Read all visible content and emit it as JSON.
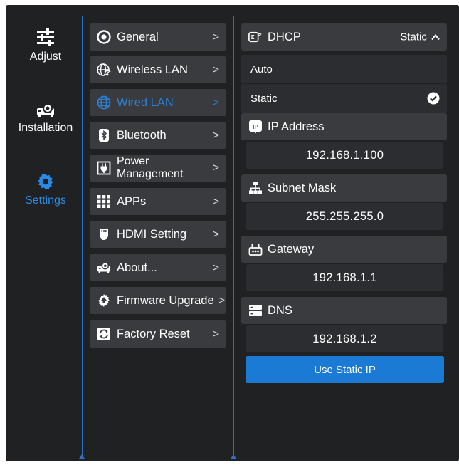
{
  "rail": [
    {
      "label": "Adjust",
      "icon": "sliders-icon",
      "active": false
    },
    {
      "label": "Installation",
      "icon": "projector-icon",
      "active": false
    },
    {
      "label": "Settings",
      "icon": "gear-icon",
      "active": true
    }
  ],
  "menu": [
    {
      "label": "General",
      "icon": "general-icon"
    },
    {
      "label": "Wireless LAN",
      "icon": "wireless-globe-icon"
    },
    {
      "label": "Wired LAN",
      "icon": "globe-icon",
      "selected": true
    },
    {
      "label": "Bluetooth",
      "icon": "bluetooth-icon"
    },
    {
      "label": "Power Management",
      "line1": "Power",
      "line2": "Management",
      "icon": "power-plug-icon"
    },
    {
      "label": "APPs",
      "icon": "apps-grid-icon"
    },
    {
      "label": "HDMI Setting",
      "icon": "hdmi-icon"
    },
    {
      "label": "About...",
      "icon": "projector-info-icon"
    },
    {
      "label": "Firmware Upgrade",
      "icon": "upgrade-icon"
    },
    {
      "label": "Factory Reset",
      "icon": "reset-icon"
    }
  ],
  "chevron": ">",
  "dhcp": {
    "label": "DHCP",
    "value": "Static",
    "caret": "^",
    "icon": "dhcp-icon"
  },
  "dhcp_options": [
    {
      "label": "Auto",
      "checked": false
    },
    {
      "label": "Static",
      "checked": true
    }
  ],
  "fields": [
    {
      "label": "IP Address",
      "value": "192.168.1.100",
      "icon": "ip-icon"
    },
    {
      "label": "Subnet Mask",
      "value": "255.255.255.0",
      "icon": "network-tree-icon"
    },
    {
      "label": "Gateway",
      "value": "192.168.1.1",
      "icon": "router-icon"
    },
    {
      "label": "DNS",
      "value": "192.168.1.2",
      "icon": "server-icon"
    }
  ],
  "action": {
    "label": "Use Static IP"
  },
  "colors": {
    "accent": "#1b7ad3",
    "selected_text": "#2a7fd8",
    "background": "#202123",
    "panel": "#3a3b3e"
  }
}
